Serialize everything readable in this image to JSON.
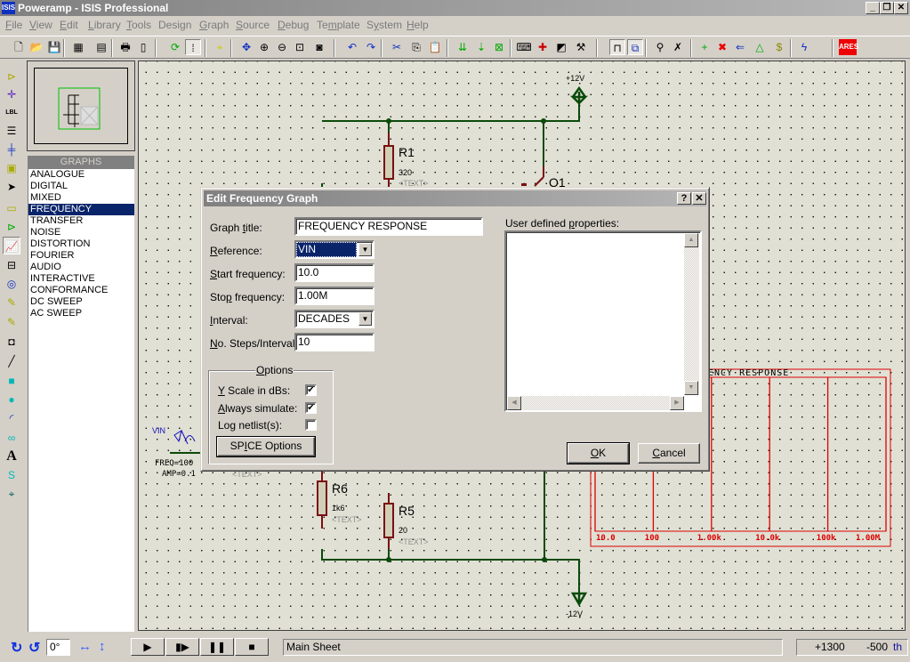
{
  "window": {
    "icon_label": "ISIS",
    "title": "Poweramp - ISIS Professional",
    "controls": {
      "minimize": "_",
      "restore": "🗗",
      "close": "✕"
    }
  },
  "menu": [
    {
      "label": "File",
      "u": "F"
    },
    {
      "label": "View",
      "u": "V"
    },
    {
      "label": "Edit",
      "u": "E"
    },
    {
      "label": "Library",
      "u": "L"
    },
    {
      "label": "Tools",
      "u": "T"
    },
    {
      "label": "Design",
      "u": "g"
    },
    {
      "label": "Graph",
      "u": "G"
    },
    {
      "label": "Source",
      "u": "S"
    },
    {
      "label": "Debug",
      "u": "D"
    },
    {
      "label": "Template",
      "u": "m"
    },
    {
      "label": "System",
      "u": "y"
    },
    {
      "label": "Help",
      "u": "H"
    }
  ],
  "toolbar": {
    "icons": [
      "new-file",
      "open-folder",
      "save",
      "import-section",
      "export-section",
      "print",
      "print-area",
      "refresh",
      "grid-toggle",
      "origin",
      "pan",
      "zoom-in",
      "zoom-out",
      "zoom-all",
      "zoom-area",
      "undo",
      "redo",
      "cut",
      "copy",
      "paste",
      "block-copy",
      "block-move",
      "block-delete",
      "pick-device",
      "make-device",
      "package-tool",
      "decompose",
      "wire-autorouter",
      "search-tag",
      "property-assignment",
      "new-sheet",
      "remove-sheet",
      "goto-sheet",
      "exit-to-parent",
      "zoom-to-child",
      "bill-of-materials",
      "electrical-rule-check",
      "netlist-to-ares"
    ],
    "ares_label": "ARES"
  },
  "left_tools": [
    "component",
    "junction",
    "wire-label",
    "text-script",
    "bus",
    "subcircuit",
    "selection",
    "terminal",
    "device-pin",
    "graph",
    "tape-recorder",
    "generator",
    "voltage-probe",
    "current-probe",
    "virtual-instrument",
    "line",
    "box",
    "circle",
    "arc",
    "path",
    "text",
    "symbol",
    "marker"
  ],
  "overview": {},
  "graphs_panel": {
    "header": "GRAPHS",
    "items": [
      "ANALOGUE",
      "DIGITAL",
      "MIXED",
      "FREQUENCY",
      "TRANSFER",
      "NOISE",
      "DISTORTION",
      "FOURIER",
      "AUDIO",
      "INTERACTIVE",
      "CONFORMANCE",
      "DC SWEEP",
      "AC SWEEP"
    ],
    "selected": "FREQUENCY"
  },
  "schematic": {
    "power_top": "+12V",
    "power_bottom": "-12V",
    "r1": {
      "ref": "R1",
      "value": "320",
      "text": "<TEXT>"
    },
    "q1": {
      "ref": "Q1"
    },
    "r6": {
      "ref": "R6",
      "value": "1k6",
      "text": "<TEXT>"
    },
    "r5": {
      "ref": "R5",
      "value": "20",
      "text": "<TEXT>"
    },
    "vin": {
      "ref": "VIN",
      "freq": "FREQ=100",
      "amp": "AMP=0.1",
      "text": "<TEXT>"
    },
    "graph": {
      "title_visible": "ENCY  RESPONSE",
      "x_ticks": [
        "10.0",
        "100",
        "1.00k",
        "10.0k",
        "100k",
        "1.00M"
      ],
      "color": "#e00000"
    }
  },
  "dialog": {
    "title": "Edit Frequency Graph",
    "help_btn": "?",
    "close_btn": "✕",
    "fields": {
      "graph_title": {
        "label": "Graph title:",
        "value": "FREQUENCY RESPONSE"
      },
      "reference": {
        "label": "Reference:",
        "value": "VIN"
      },
      "start_frequency": {
        "label": "Start frequency:",
        "value": "10.0"
      },
      "stop_frequency": {
        "label": "Stop frequency:",
        "value": "1.00M"
      },
      "interval": {
        "label": "Interval:",
        "value": "DECADES"
      },
      "steps": {
        "label": "No. Steps/Interval:",
        "value": "10"
      }
    },
    "options": {
      "legend": "Options",
      "y_scale_db": {
        "label": "Y Scale in dBs:",
        "checked": true
      },
      "always_simulate": {
        "label": "Always simulate:",
        "checked": true
      },
      "log_netlist": {
        "label": "Log netlist(s):",
        "checked": false
      },
      "spice_button": "SPICE Options"
    },
    "user_props_label": "User defined properties:",
    "user_props_value": "",
    "ok": "OK",
    "cancel": "Cancel"
  },
  "statusbar": {
    "rotation": "0°",
    "sim_controls": [
      "play",
      "step",
      "pause",
      "stop"
    ],
    "sheet": "Main Sheet",
    "coord_x": "+1300",
    "coord_y": "-500",
    "units": "th"
  }
}
